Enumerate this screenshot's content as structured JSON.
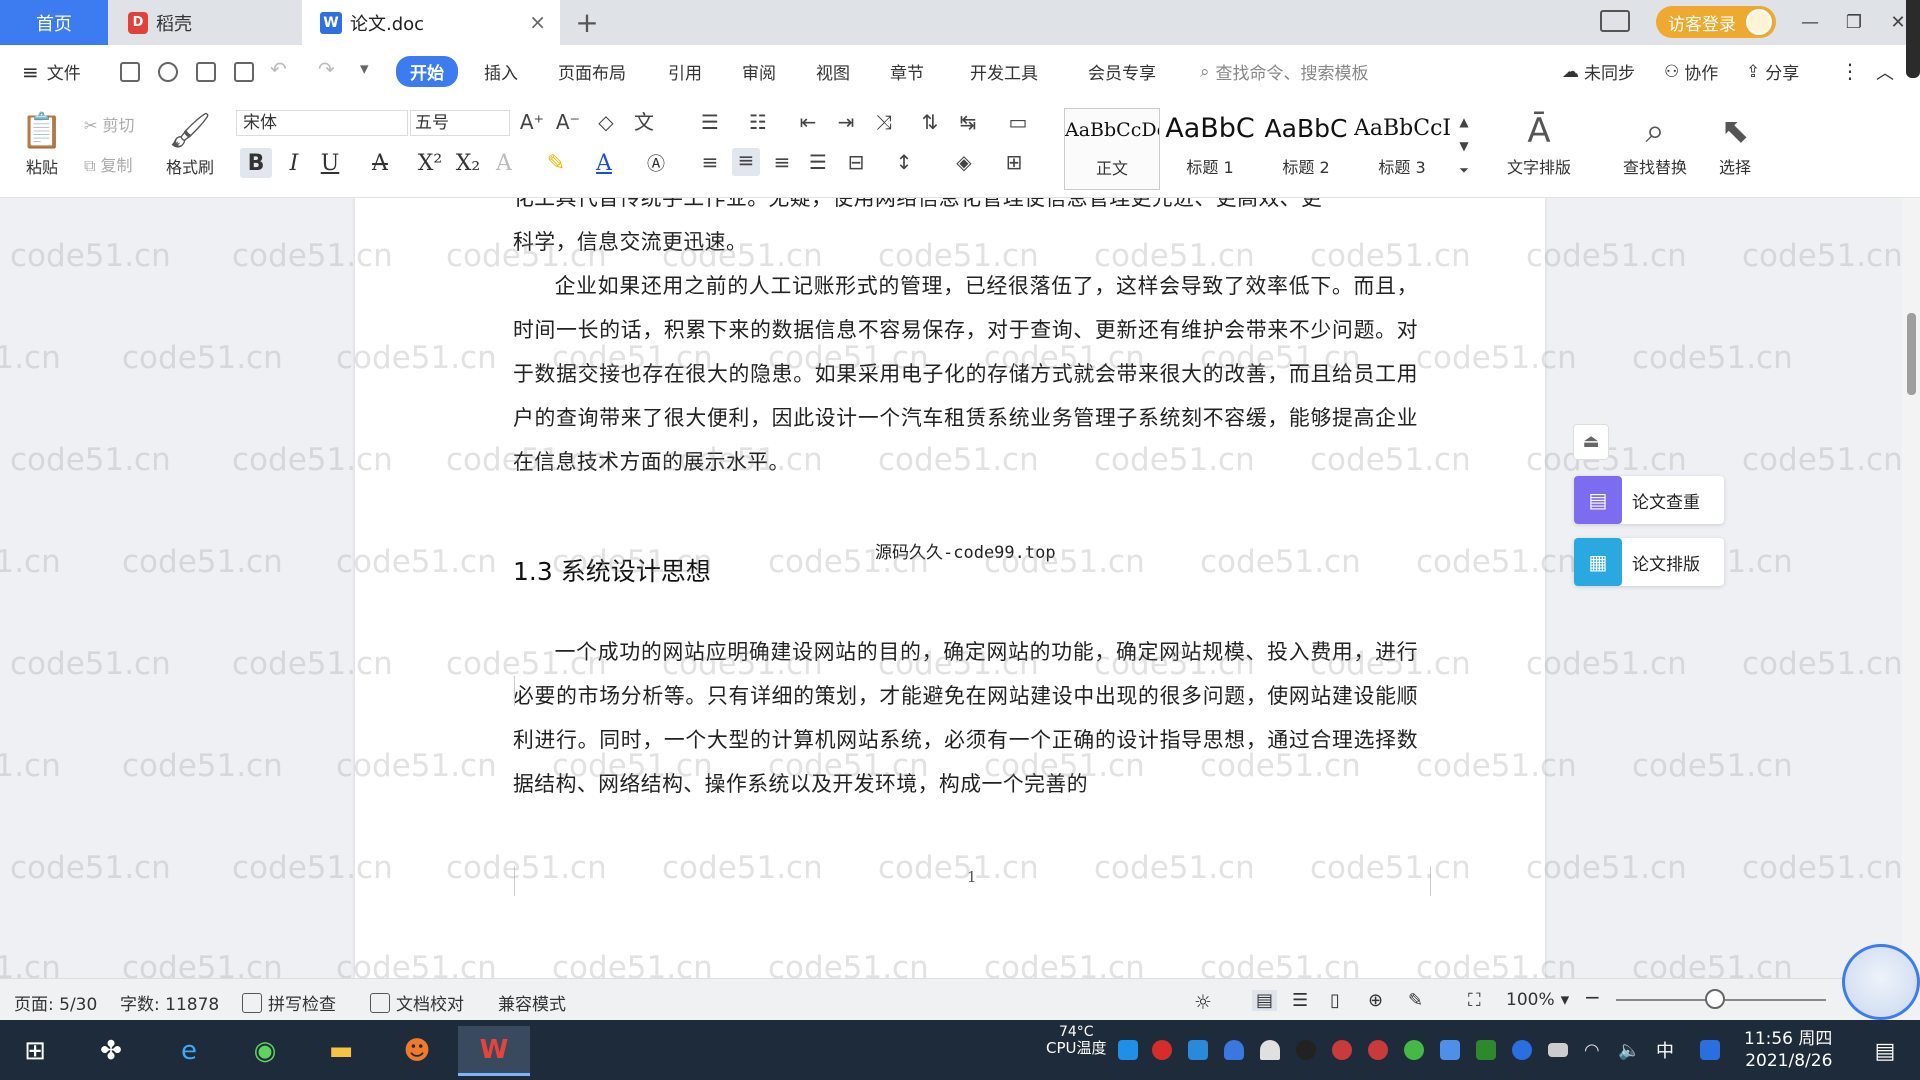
{
  "tabs": {
    "home": "首页",
    "doc1": "稻壳",
    "doc2": "论文.doc"
  },
  "window": {
    "visitor_login": "访客登录"
  },
  "menu": {
    "file": "文件",
    "items": [
      "开始",
      "插入",
      "页面布局",
      "引用",
      "审阅",
      "视图",
      "章节",
      "开发工具",
      "会员专享"
    ],
    "search_placeholder": "查找命令、搜索模板",
    "not_synced": "未同步",
    "collaborate": "协作",
    "share": "分享"
  },
  "ribbon": {
    "paste": "粘贴",
    "cut": "剪切",
    "copy": "复制",
    "format_painter": "格式刷",
    "font_name": "宋体",
    "font_size": "五号",
    "styles": [
      {
        "sample": "AaBbCcDd",
        "name": "正文"
      },
      {
        "sample": "AaBbC",
        "name": "标题 1"
      },
      {
        "sample": "AaBbC",
        "name": "标题 2"
      },
      {
        "sample": "AaBbCcI",
        "name": "标题 3"
      }
    ],
    "text_layout": "文字排版",
    "find_replace": "查找替换",
    "select": "选择"
  },
  "document": {
    "partial_top_line": "化工具代替传统手工作业。无疑，使用网络信息化管理使信息管理更先进、更高效、更",
    "para1_end": "科学，信息交流更迅速。",
    "para2": "企业如果还用之前的人工记账形式的管理，已经很落伍了，这样会导致了效率低下。而且，时间一长的话，积累下来的数据信息不容易保存，对于查询、更新还有维护会带来不少问题。对于数据交接也存在很大的隐患。如果采用电子化的存储方式就会带来很大的改善，而且给员工用户的查询带来了很大便利，因此设计一个汽车租赁系统业务管理子系统刻不容缓，能够提高企业在信息技术方面的展示水平。",
    "code_note": "源码久久-code99.top",
    "heading": "1.3 系统设计思想",
    "para3": "一个成功的网站应明确建设网站的目的，确定网站的功能，确定网站规模、投入费用，进行必要的市场分析等。只有详细的策划，才能避免在网站建设中出现的很多问题，使网站建设能顺利进行。同时，一个大型的计算机网站系统，必须有一个正确的设计指导思想，通过合理选择数据结构、网络结构、操作系统以及开发环境，构成一个完善的",
    "page_number": "1",
    "watermark": "code51.cn"
  },
  "side_panel": {
    "check": "论文查重",
    "layout": "论文排版"
  },
  "status": {
    "page": "页面: 5/30",
    "words": "字数: 11878",
    "spell": "拼写检查",
    "proof": "文档校对",
    "compat": "兼容模式",
    "zoom": "100%"
  },
  "taskbar": {
    "temp": "74°C",
    "temp_label": "CPU温度",
    "time": "11:56 周四",
    "date": "2021/8/26",
    "ime": "中"
  },
  "colors": {
    "accent": "#3d7bf0",
    "visitor": "#f0a930"
  }
}
